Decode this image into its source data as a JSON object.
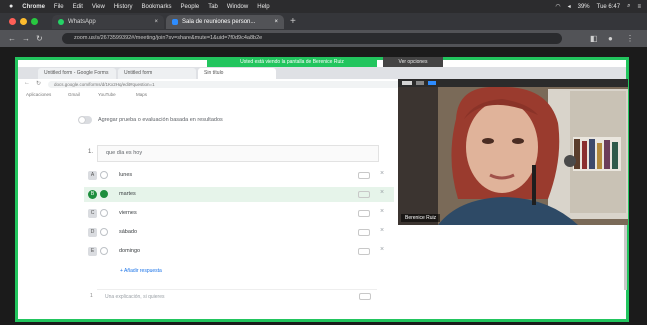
{
  "menubar": {
    "apple": "",
    "items": [
      "Chrome",
      "File",
      "Edit",
      "View",
      "History",
      "Bookmarks",
      "People",
      "Tab",
      "Window",
      "Help"
    ],
    "status_right": [
      "39%",
      "Tue 6:47"
    ]
  },
  "browser": {
    "tabs": [
      {
        "label": "WhatsApp"
      },
      {
        "label": "Sala de reuniones person..."
      }
    ],
    "url": "zoom.us/s/2673599392#/meeting/join?sv=share&mute=1&uid=7f0d9c4a8b2e",
    "colors": {
      "traffic_red": "#ff5f57",
      "traffic_yellow": "#febc2e",
      "traffic_green": "#28c840"
    }
  },
  "share": {
    "banner": "Usted está viendo la pantalla de Berenice Ruiz",
    "options_label": "Ver opciones",
    "border_color": "#22c55e"
  },
  "inner": {
    "tabs": [
      {
        "label": "Untitled form - Google Forms"
      },
      {
        "label": "Untitled form"
      },
      {
        "label": "Sin título"
      }
    ],
    "url": "docs.google.com/forms/d/1Kx2Hq/edit#question=1",
    "bookmarks": [
      "Aplicaciones",
      "Gmail",
      "YouTube",
      "Maps"
    ],
    "toggle_label": "Agregar prueba o evaluación basada en resultados",
    "question": {
      "number": "1.",
      "title": "que día es hoy"
    },
    "options": [
      {
        "letter": "A",
        "label": "lunes",
        "selected": false
      },
      {
        "letter": "B",
        "label": "martes",
        "selected": true
      },
      {
        "letter": "C",
        "label": "viernes",
        "selected": false
      },
      {
        "letter": "D",
        "label": "sábado",
        "selected": false
      },
      {
        "letter": "E",
        "label": "domingo",
        "selected": false
      }
    ],
    "add_answer": "+ Añadir respuesta",
    "explanation_placeholder": "Una explicación, si quieres",
    "explanation_number": "1"
  },
  "video": {
    "participant_name": "Berenice Ruiz"
  }
}
